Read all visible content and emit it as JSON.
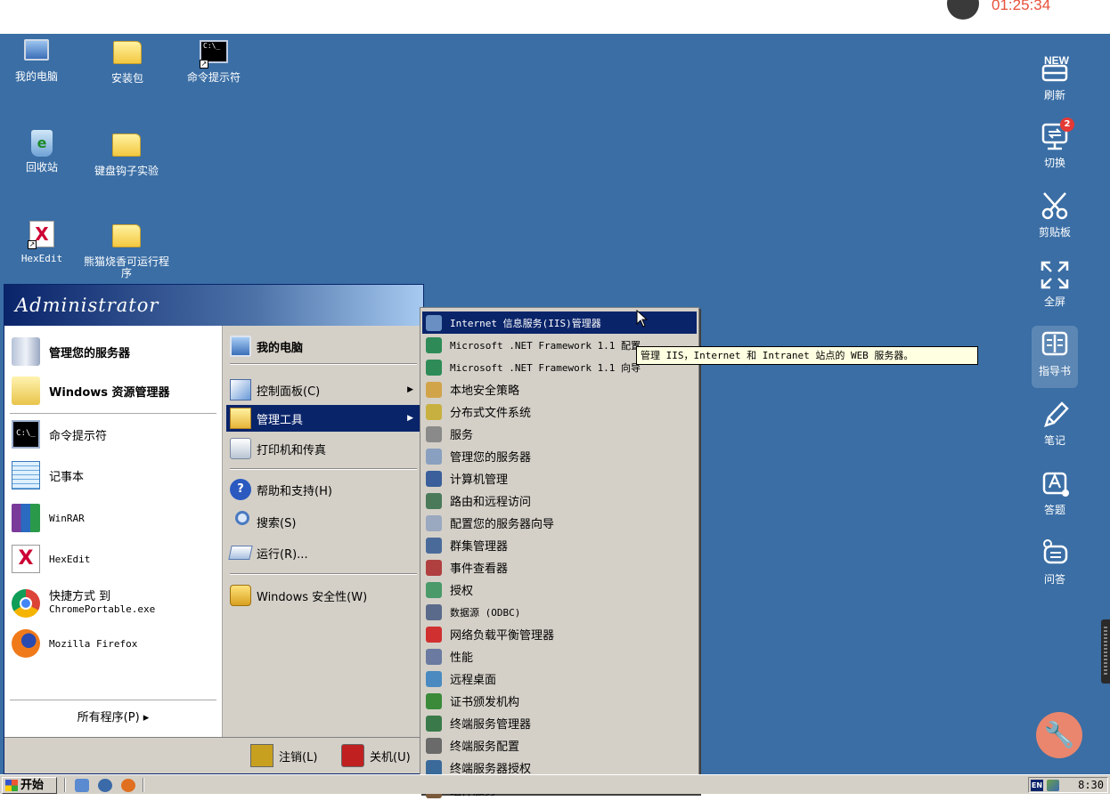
{
  "timer": "01:25:34",
  "desktop_icons": [
    {
      "label": "我的电脑",
      "icon": "computer-icon"
    },
    {
      "label": "安装包",
      "icon": "folder-icon"
    },
    {
      "label": "命令提示符",
      "icon": "cmd-icon"
    },
    {
      "label": "回收站",
      "icon": "recycle-bin-icon"
    },
    {
      "label": "键盘钩子实验",
      "icon": "folder-icon"
    },
    {
      "label": "HexEdit",
      "icon": "hexedit-icon"
    },
    {
      "label": "熊猫烧香可运行程序",
      "icon": "folder-icon"
    }
  ],
  "sidebar": [
    {
      "label": "刷新",
      "icon": "new-refresh-icon"
    },
    {
      "label": "切换",
      "icon": "switch-monitor-icon",
      "badge": "2"
    },
    {
      "label": "剪贴板",
      "icon": "scissors-icon"
    },
    {
      "label": "全屏",
      "icon": "fullscreen-icon"
    },
    {
      "label": "指导书",
      "icon": "book-icon"
    },
    {
      "label": "笔记",
      "icon": "pencil-icon"
    },
    {
      "label": "答题",
      "icon": "answer-icon"
    },
    {
      "label": "问答",
      "icon": "chat-icon"
    }
  ],
  "start_menu": {
    "user": "Administrator",
    "left_pinned": [
      {
        "label": "管理您的服务器",
        "icon": "server-icon"
      },
      {
        "label": "Windows 资源管理器",
        "icon": "explorer-icon"
      }
    ],
    "left_recent": [
      {
        "label": "命令提示符",
        "icon": "cmd-icon"
      },
      {
        "label": "记事本",
        "icon": "notepad-icon"
      },
      {
        "label": "WinRAR",
        "icon": "winrar-icon"
      },
      {
        "label": "HexEdit",
        "icon": "hexedit-icon"
      },
      {
        "label": "快捷方式 到",
        "label2": "ChromePortable.exe",
        "icon": "chrome-icon"
      },
      {
        "label": "Mozilla Firefox",
        "icon": "firefox-icon"
      }
    ],
    "all_programs": "所有程序(P) ▸",
    "right_items": [
      {
        "label": "我的电脑",
        "icon": "computer-icon"
      },
      {
        "label": "控制面板(C)",
        "icon": "control-panel-icon"
      },
      {
        "label": "管理工具",
        "icon": "admin-tools-icon"
      },
      {
        "label": "打印机和传真",
        "icon": "printer-icon"
      },
      {
        "label": "帮助和支持(H)",
        "icon": "help-icon"
      },
      {
        "label": "搜索(S)",
        "icon": "search-icon"
      },
      {
        "label": "运行(R)...",
        "icon": "run-icon"
      },
      {
        "label": "Windows 安全性(W)",
        "icon": "lock-icon"
      }
    ],
    "logoff": "注销(L)",
    "shutdown": "关机(U)"
  },
  "admin_submenu": [
    {
      "label": "Internet 信息服务(IIS)管理器",
      "icon": "iis-icon",
      "color": "#6a8fc2"
    },
    {
      "label": "Microsoft .NET Framework 1.1 配置",
      "icon": "dotnet-icon",
      "color": "#2e8b57"
    },
    {
      "label": "Microsoft .NET Framework 1.1 向导",
      "icon": "dotnet-icon",
      "color": "#2e8b57"
    },
    {
      "label": "本地安全策略",
      "icon": "policy-icon",
      "color": "#d2a44a"
    },
    {
      "label": "分布式文件系统",
      "icon": "dfs-icon",
      "color": "#c8b040"
    },
    {
      "label": "服务",
      "icon": "services-icon",
      "color": "#8a8a8a"
    },
    {
      "label": "管理您的服务器",
      "icon": "server-icon",
      "color": "#8aa0c0"
    },
    {
      "label": "计算机管理",
      "icon": "computer-mgmt-icon",
      "color": "#3a5f9a"
    },
    {
      "label": "路由和远程访问",
      "icon": "routing-icon",
      "color": "#4a7a5a"
    },
    {
      "label": "配置您的服务器向导",
      "icon": "wizard-icon",
      "color": "#9aa8c0"
    },
    {
      "label": "群集管理器",
      "icon": "cluster-icon",
      "color": "#4a6a9a"
    },
    {
      "label": "事件查看器",
      "icon": "event-viewer-icon",
      "color": "#b04040"
    },
    {
      "label": "授权",
      "icon": "license-icon",
      "color": "#4a9a6a"
    },
    {
      "label": "数据源 (ODBC)",
      "icon": "odbc-icon",
      "color": "#5a6a8a"
    },
    {
      "label": "网络负载平衡管理器",
      "icon": "nlb-icon",
      "color": "#d03030"
    },
    {
      "label": "性能",
      "icon": "performance-icon",
      "color": "#6a7aa0"
    },
    {
      "label": "远程桌面",
      "icon": "remote-desktop-icon",
      "color": "#4a8ac0"
    },
    {
      "label": "证书颁发机构",
      "icon": "cert-icon",
      "color": "#3a8a3a"
    },
    {
      "label": "终端服务管理器",
      "icon": "ts-manager-icon",
      "color": "#3a7a4a"
    },
    {
      "label": "终端服务配置",
      "icon": "ts-config-icon",
      "color": "#6a6a6a"
    },
    {
      "label": "终端服务器授权",
      "icon": "ts-license-icon",
      "color": "#3a6a9a"
    },
    {
      "label": "组件服务",
      "icon": "component-icon",
      "color": "#7a5a3a"
    }
  ],
  "tooltip": "管理 IIS，Internet 和 Intranet 站点的 WEB 服务器。",
  "taskbar": {
    "start": "开始",
    "lang": "EN",
    "clock": "8:30"
  }
}
